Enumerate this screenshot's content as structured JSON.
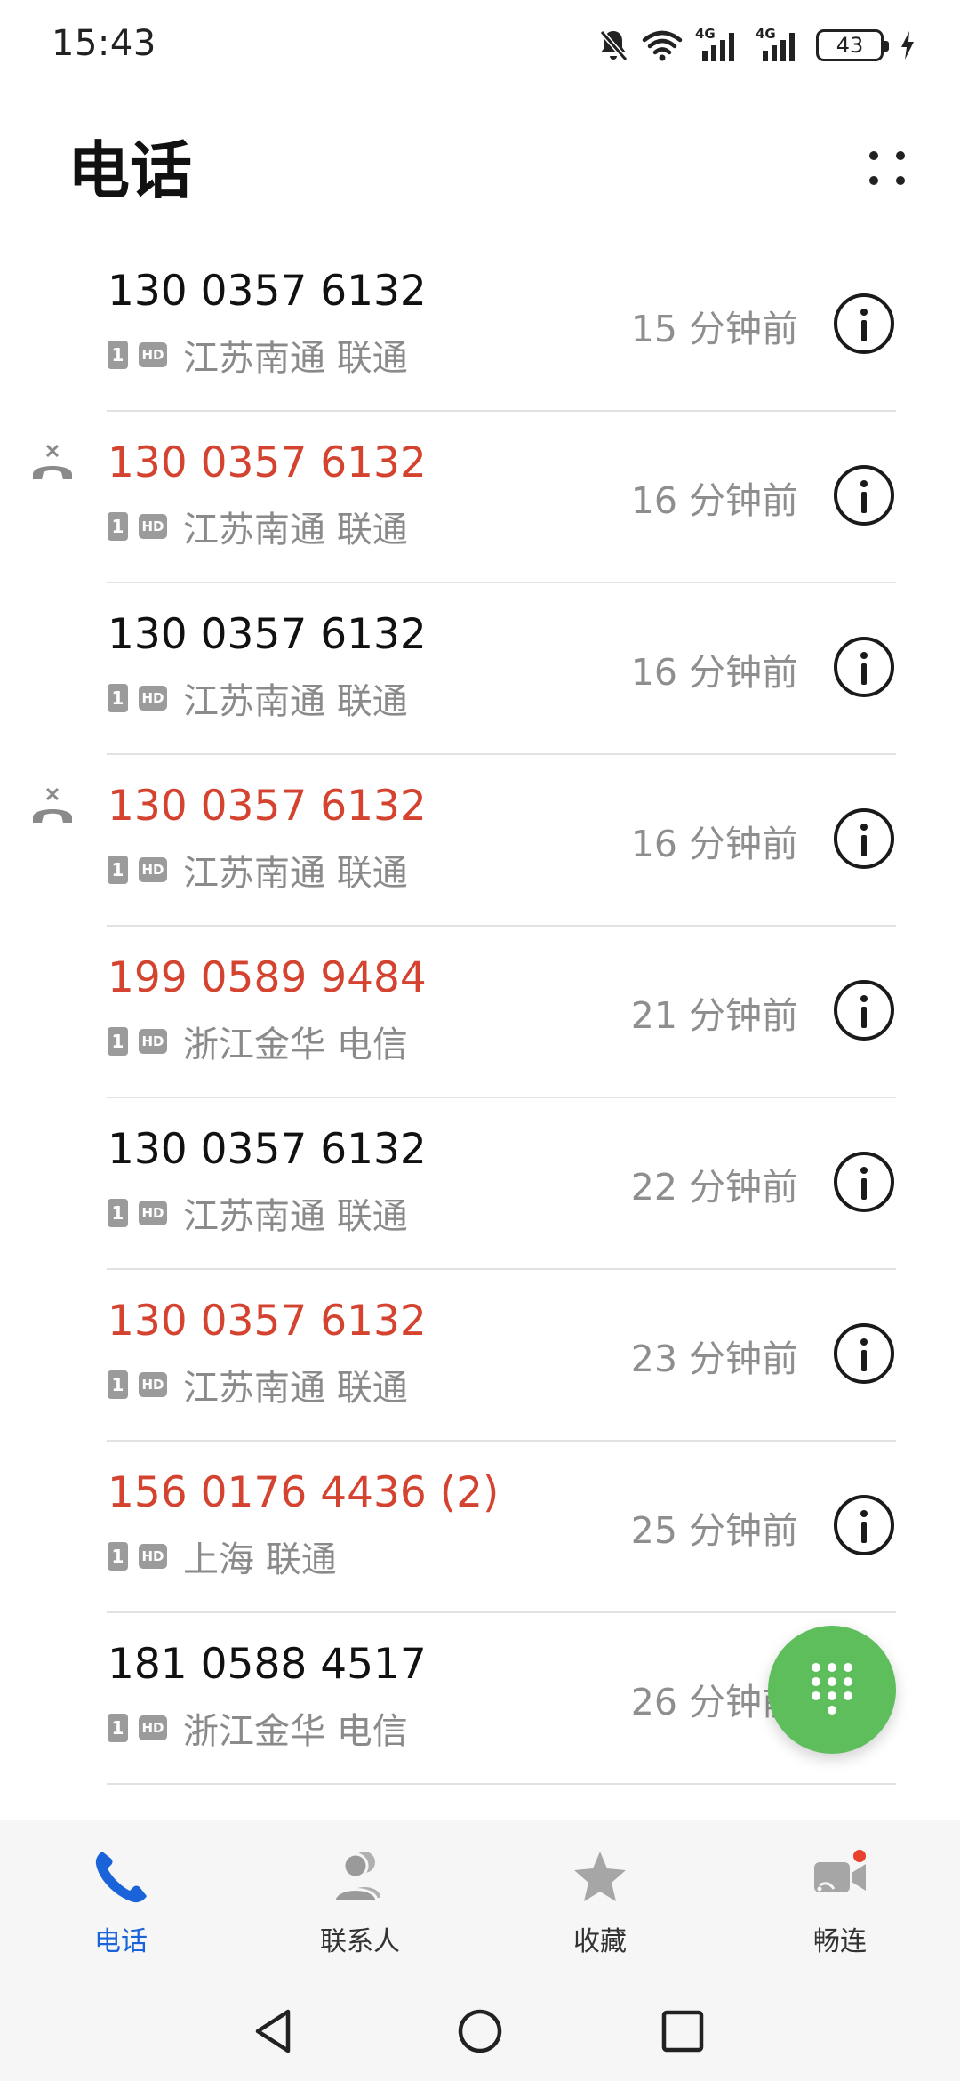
{
  "status_bar": {
    "time": "15:43",
    "battery": "43",
    "network_1": "4G",
    "network_2": "4G"
  },
  "header": {
    "title": "电话"
  },
  "calls": [
    {
      "number": "130 0357 6132",
      "sim": "1",
      "hd": "HD",
      "location": "江苏南通 联通",
      "time_ago": "15 分钟前",
      "missed": false,
      "rejected": false
    },
    {
      "number": "130 0357 6132",
      "sim": "1",
      "hd": "HD",
      "location": "江苏南通 联通",
      "time_ago": "16 分钟前",
      "missed": true,
      "rejected": true
    },
    {
      "number": "130 0357 6132",
      "sim": "1",
      "hd": "HD",
      "location": "江苏南通 联通",
      "time_ago": "16 分钟前",
      "missed": false,
      "rejected": false
    },
    {
      "number": "130 0357 6132",
      "sim": "1",
      "hd": "HD",
      "location": "江苏南通 联通",
      "time_ago": "16 分钟前",
      "missed": true,
      "rejected": true
    },
    {
      "number": "199 0589 9484",
      "sim": "1",
      "hd": "HD",
      "location": "浙江金华 电信",
      "time_ago": "21 分钟前",
      "missed": true,
      "rejected": false
    },
    {
      "number": "130 0357 6132",
      "sim": "1",
      "hd": "HD",
      "location": "江苏南通 联通",
      "time_ago": "22 分钟前",
      "missed": false,
      "rejected": false
    },
    {
      "number": "130 0357 6132",
      "sim": "1",
      "hd": "HD",
      "location": "江苏南通 联通",
      "time_ago": "23 分钟前",
      "missed": true,
      "rejected": false
    },
    {
      "number": "156 0176 4436 (2)",
      "sim": "1",
      "hd": "HD",
      "location": "上海 联通",
      "time_ago": "25 分钟前",
      "missed": true,
      "rejected": false
    },
    {
      "number": "181 0588 4517",
      "sim": "1",
      "hd": "HD",
      "location": "浙江金华 电信",
      "time_ago": "26 分钟前",
      "missed": false,
      "rejected": false
    }
  ],
  "bottom_nav": {
    "items": [
      {
        "label": "电话",
        "icon": "phone-icon",
        "active": true
      },
      {
        "label": "联系人",
        "icon": "contacts-icon",
        "active": false
      },
      {
        "label": "收藏",
        "icon": "star-icon",
        "active": false
      },
      {
        "label": "畅连",
        "icon": "video-call-icon",
        "active": false,
        "badge": true
      }
    ]
  },
  "colors": {
    "missed": "#d4432f",
    "accent": "#1a63d8",
    "fab": "#5ebe5c",
    "badge": "#e8412e"
  }
}
